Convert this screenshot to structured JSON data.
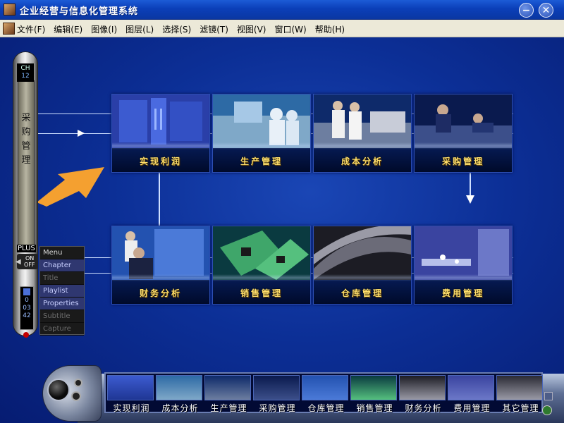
{
  "window": {
    "title": "企业经营与信息化管理系统",
    "min_glyph": "−",
    "close_glyph": "✕"
  },
  "menu": {
    "items": [
      "文件(F)",
      "编辑(E)",
      "图像(I)",
      "图层(L)",
      "选择(S)",
      "滤镜(T)",
      "视图(V)",
      "窗口(W)",
      "帮助(H)"
    ]
  },
  "tiles": [
    {
      "label": "实现利润"
    },
    {
      "label": "生产管理"
    },
    {
      "label": "成本分析"
    },
    {
      "label": "采购管理"
    },
    {
      "label": "财务分析"
    },
    {
      "label": "销售管理"
    },
    {
      "label": "仓库管理"
    },
    {
      "label": "费用管理"
    }
  ],
  "pillar": {
    "ch_label": "CH",
    "ch_number": "12",
    "vertical_title": "采购管理",
    "plus_label": "PLUS",
    "on_label": "ON",
    "off_label": "OFF",
    "counter_top": "0",
    "counter_mid": "03",
    "counter_bot": "42"
  },
  "popup": {
    "items": [
      {
        "label": "Menu",
        "state": "normal"
      },
      {
        "label": "Chapter",
        "state": "highlight"
      },
      {
        "label": "Title",
        "state": "dim"
      },
      {
        "label": "Playlist",
        "state": "highlight"
      },
      {
        "label": "Properties",
        "state": "highlight"
      },
      {
        "label": "Subtitle",
        "state": "dim"
      },
      {
        "label": "Capture",
        "state": "dim"
      }
    ]
  },
  "dock": {
    "items": [
      "实现利润",
      "成本分析",
      "生产管理",
      "采购管理",
      "仓库管理",
      "销售管理",
      "财务分析",
      "费用管理",
      "其它管理"
    ]
  },
  "colors": {
    "background": "#0c2f96",
    "tile_label": "#ffdf6b",
    "orange_arrow": "#f4a030",
    "line": "#cfe0ff"
  }
}
